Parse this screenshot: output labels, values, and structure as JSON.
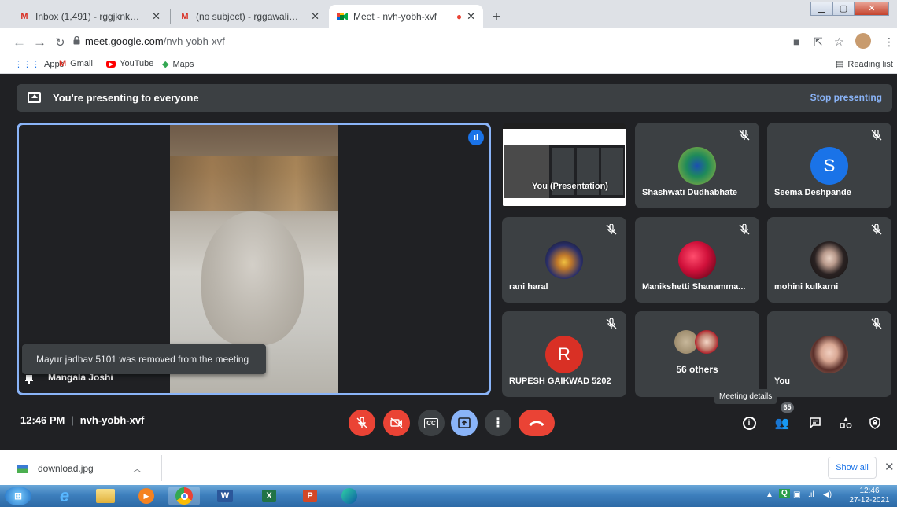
{
  "browser": {
    "tabs": [
      {
        "title": "Inbox (1,491) - rggjknk@gmail.co",
        "favicon": "gmail-icon",
        "active": false
      },
      {
        "title": "(no subject) - rggawali@dayanan",
        "favicon": "gmail-icon",
        "active": false
      },
      {
        "title": "Meet - nvh-yobh-xvf",
        "favicon": "meet-icon",
        "active": true
      }
    ],
    "url_host": "meet.google.com",
    "url_path": "/nvh-yobh-xvf",
    "bookmarks": [
      {
        "label": "Apps",
        "icon": "apps-grid-icon"
      },
      {
        "label": "Gmail",
        "icon": "gmail-icon"
      },
      {
        "label": "YouTube",
        "icon": "youtube-icon"
      },
      {
        "label": "Maps",
        "icon": "maps-icon"
      }
    ],
    "reading_list": "Reading list"
  },
  "meet": {
    "banner_message": "You're presenting to everyone",
    "stop_presenting": "Stop presenting",
    "main_name": "Mangala Joshi",
    "toast": "Mayur jadhav 5101 was removed from the meeting",
    "presentation_caption": "You (Presentation)",
    "tiles": [
      {
        "name": "Shashwati Dudhabhate",
        "avatar": "peacock-feather",
        "muted": true
      },
      {
        "name": "Seema Deshpande",
        "avatar_letter": "S",
        "avatar_color": "#1a73e8",
        "muted": true
      },
      {
        "name": "rani haral",
        "avatar": "temple-photo",
        "muted": true
      },
      {
        "name": "Manikshetti Shanamma...",
        "avatar": "roses-photo",
        "muted": true
      },
      {
        "name": "mohini kulkarni",
        "avatar": "girl-photo",
        "muted": true
      },
      {
        "name": "RUPESH GAIKWAD 5202",
        "avatar_letter": "R",
        "avatar_color": "#d93025",
        "muted": true
      },
      {
        "name": "56 others",
        "avatar": "group-photos",
        "muted": false
      },
      {
        "name": "You",
        "avatar": "woman-photo",
        "muted": true
      }
    ],
    "time": "12:46 PM",
    "meeting_code": "nvh-yobh-xvf",
    "tooltip": "Meeting details",
    "participant_count": "65"
  },
  "downloads": {
    "file": "download.jpg",
    "show_all": "Show all"
  },
  "taskbar": {
    "time": "12:46",
    "date": "27-12-2021"
  }
}
